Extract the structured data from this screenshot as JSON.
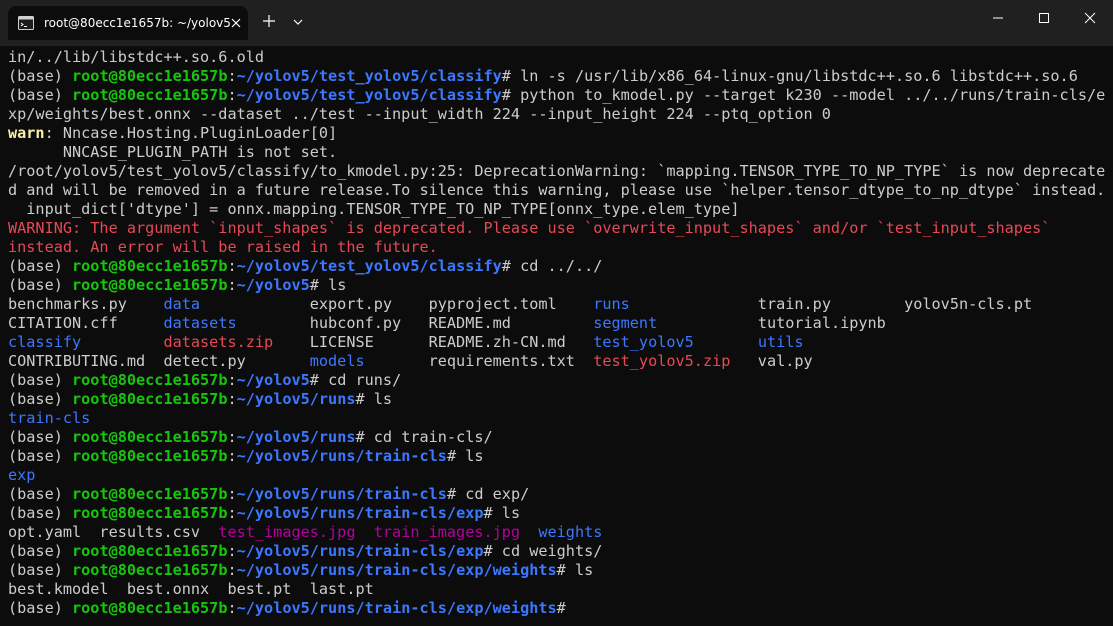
{
  "window": {
    "tab_title": "root@80ecc1e1657b: ~/yolov5"
  },
  "colors": {
    "background": "#0c0c0c",
    "titlebar": "#202020",
    "green": "#16c60c",
    "blue": "#3b78ff",
    "red": "#e74856",
    "magenta": "#b4009e",
    "yellow": "#f9f1a5",
    "text": "#cccccc"
  },
  "icons": {
    "tab": "terminal-icon",
    "close_tab": "close-icon",
    "new_tab": "plus-icon",
    "dropdown": "chevron-down-icon",
    "minimize": "minimize-icon",
    "maximize": "maximize-icon",
    "close_window": "close-icon"
  },
  "terminal": {
    "lines": [
      [
        {
          "t": "in/../lib/libstdc++.so.6.old",
          "c": "w"
        }
      ],
      [
        {
          "t": "(base) ",
          "c": "w"
        },
        {
          "t": "root@80ecc1e1657b",
          "c": "g"
        },
        {
          "t": ":",
          "c": "w"
        },
        {
          "t": "~/yolov5/test_yolov5/classify",
          "c": "b"
        },
        {
          "t": "# ln -s /usr/lib/x86_64-linux-gnu/libstdc++.so.6 libstdc++.so.6",
          "c": "w"
        }
      ],
      [
        {
          "t": "(base) ",
          "c": "w"
        },
        {
          "t": "root@80ecc1e1657b",
          "c": "g"
        },
        {
          "t": ":",
          "c": "w"
        },
        {
          "t": "~/yolov5/test_yolov5/classify",
          "c": "b"
        },
        {
          "t": "# python to_kmodel.py --target k230 --model ../../runs/train-cls/e",
          "c": "w"
        }
      ],
      [
        {
          "t": "xp/weights/best.onnx --dataset ../test --input_width 224 --input_height 224 --ptq_option 0",
          "c": "w"
        }
      ],
      [
        {
          "t": "warn",
          "c": "y"
        },
        {
          "t": ": Nncase.Hosting.PluginLoader[0]",
          "c": "w"
        }
      ],
      [
        {
          "t": "      NNCASE_PLUGIN_PATH is not set.",
          "c": "w"
        }
      ],
      [
        {
          "t": "/root/yolov5/test_yolov5/classify/to_kmodel.py:25: DeprecationWarning: `mapping.TENSOR_TYPE_TO_NP_TYPE` is now deprecate",
          "c": "w"
        }
      ],
      [
        {
          "t": "d and will be removed in a future release.To silence this warning, please use `helper.tensor_dtype_to_np_dtype` instead.",
          "c": "w"
        }
      ],
      [
        {
          "t": "  input_dict['dtype'] = onnx.mapping.TENSOR_TYPE_TO_NP_TYPE[onnx_type.elem_type]",
          "c": "w"
        }
      ],
      [
        {
          "t": "WARNING: The argument `input_shapes` is deprecated. Please use `overwrite_input_shapes` and/or `test_input_shapes`",
          "c": "r"
        }
      ],
      [
        {
          "t": "instead. An error will be raised in the future.",
          "c": "r"
        }
      ],
      [
        {
          "t": "(base) ",
          "c": "w"
        },
        {
          "t": "root@80ecc1e1657b",
          "c": "g"
        },
        {
          "t": ":",
          "c": "w"
        },
        {
          "t": "~/yolov5/test_yolov5/classify",
          "c": "b"
        },
        {
          "t": "# cd ../../",
          "c": "w"
        }
      ],
      [
        {
          "t": "(base) ",
          "c": "w"
        },
        {
          "t": "root@80ecc1e1657b",
          "c": "g"
        },
        {
          "t": ":",
          "c": "w"
        },
        {
          "t": "~/yolov5",
          "c": "b"
        },
        {
          "t": "# ls",
          "c": "w"
        }
      ],
      [
        {
          "t": "benchmarks.py    ",
          "c": "w"
        },
        {
          "t": "data",
          "c": "bb"
        },
        {
          "t": "            export.py    pyproject.toml    ",
          "c": "w"
        },
        {
          "t": "runs",
          "c": "bb"
        },
        {
          "t": "              train.py        yolov5n-cls.pt",
          "c": "w"
        }
      ],
      [
        {
          "t": "CITATION.cff     ",
          "c": "w"
        },
        {
          "t": "datasets",
          "c": "bb"
        },
        {
          "t": "        hubconf.py   README.md         ",
          "c": "w"
        },
        {
          "t": "segment",
          "c": "bb"
        },
        {
          "t": "           tutorial.ipynb",
          "c": "w"
        }
      ],
      [
        {
          "t": "classify",
          "c": "bb"
        },
        {
          "t": "         ",
          "c": "w"
        },
        {
          "t": "datasets.zip",
          "c": "rb"
        },
        {
          "t": "    LICENSE      README.zh-CN.md   ",
          "c": "w"
        },
        {
          "t": "test_yolov5",
          "c": "bb"
        },
        {
          "t": "       ",
          "c": "w"
        },
        {
          "t": "utils",
          "c": "bb"
        }
      ],
      [
        {
          "t": "CONTRIBUTING.md  detect.py       ",
          "c": "w"
        },
        {
          "t": "models",
          "c": "bb"
        },
        {
          "t": "       requirements.txt  ",
          "c": "w"
        },
        {
          "t": "test_yolov5.zip",
          "c": "rb"
        },
        {
          "t": "   val.py",
          "c": "w"
        }
      ],
      [
        {
          "t": "(base) ",
          "c": "w"
        },
        {
          "t": "root@80ecc1e1657b",
          "c": "g"
        },
        {
          "t": ":",
          "c": "w"
        },
        {
          "t": "~/yolov5",
          "c": "b"
        },
        {
          "t": "# cd runs/",
          "c": "w"
        }
      ],
      [
        {
          "t": "(base) ",
          "c": "w"
        },
        {
          "t": "root@80ecc1e1657b",
          "c": "g"
        },
        {
          "t": ":",
          "c": "w"
        },
        {
          "t": "~/yolov5/runs",
          "c": "b"
        },
        {
          "t": "# ls",
          "c": "w"
        }
      ],
      [
        {
          "t": "train-cls",
          "c": "bb"
        }
      ],
      [
        {
          "t": "(base) ",
          "c": "w"
        },
        {
          "t": "root@80ecc1e1657b",
          "c": "g"
        },
        {
          "t": ":",
          "c": "w"
        },
        {
          "t": "~/yolov5/runs",
          "c": "b"
        },
        {
          "t": "# cd train-cls/",
          "c": "w"
        }
      ],
      [
        {
          "t": "(base) ",
          "c": "w"
        },
        {
          "t": "root@80ecc1e1657b",
          "c": "g"
        },
        {
          "t": ":",
          "c": "w"
        },
        {
          "t": "~/yolov5/runs/train-cls",
          "c": "b"
        },
        {
          "t": "# ls",
          "c": "w"
        }
      ],
      [
        {
          "t": "exp",
          "c": "bb"
        }
      ],
      [
        {
          "t": "(base) ",
          "c": "w"
        },
        {
          "t": "root@80ecc1e1657b",
          "c": "g"
        },
        {
          "t": ":",
          "c": "w"
        },
        {
          "t": "~/yolov5/runs/train-cls",
          "c": "b"
        },
        {
          "t": "# cd exp/",
          "c": "w"
        }
      ],
      [
        {
          "t": "(base) ",
          "c": "w"
        },
        {
          "t": "root@80ecc1e1657b",
          "c": "g"
        },
        {
          "t": ":",
          "c": "w"
        },
        {
          "t": "~/yolov5/runs/train-cls/exp",
          "c": "b"
        },
        {
          "t": "# ls",
          "c": "w"
        }
      ],
      [
        {
          "t": "opt.yaml  results.csv  ",
          "c": "w"
        },
        {
          "t": "test_images.jpg",
          "c": "m"
        },
        {
          "t": "  ",
          "c": "w"
        },
        {
          "t": "train_images.jpg",
          "c": "m"
        },
        {
          "t": "  ",
          "c": "w"
        },
        {
          "t": "weights",
          "c": "bb"
        }
      ],
      [
        {
          "t": "(base) ",
          "c": "w"
        },
        {
          "t": "root@80ecc1e1657b",
          "c": "g"
        },
        {
          "t": ":",
          "c": "w"
        },
        {
          "t": "~/yolov5/runs/train-cls/exp",
          "c": "b"
        },
        {
          "t": "# cd weights/",
          "c": "w"
        }
      ],
      [
        {
          "t": "(base) ",
          "c": "w"
        },
        {
          "t": "root@80ecc1e1657b",
          "c": "g"
        },
        {
          "t": ":",
          "c": "w"
        },
        {
          "t": "~/yolov5/runs/train-cls/exp/weights",
          "c": "b"
        },
        {
          "t": "# ls",
          "c": "w"
        }
      ],
      [
        {
          "t": "best.kmodel  best.onnx  best.pt  last.pt",
          "c": "w"
        }
      ],
      [
        {
          "t": "(base) ",
          "c": "w"
        },
        {
          "t": "root@80ecc1e1657b",
          "c": "g"
        },
        {
          "t": ":",
          "c": "w"
        },
        {
          "t": "~/yolov5/runs/train-cls/exp/weights",
          "c": "b"
        },
        {
          "t": "#",
          "c": "w"
        }
      ]
    ]
  }
}
